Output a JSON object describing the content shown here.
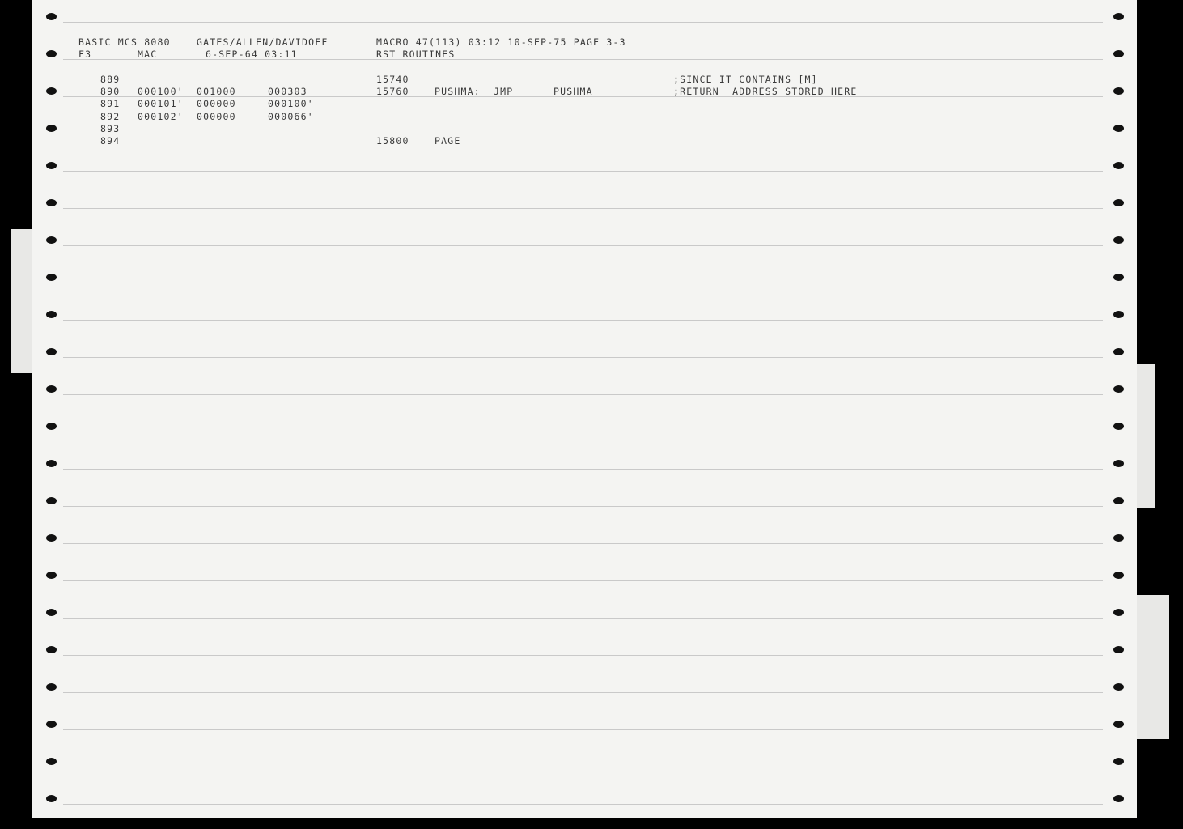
{
  "header": {
    "line1": {
      "program": "BASIC MCS 8080",
      "authors": "GATES/ALLEN/DAVIDOFF",
      "assembler": "MACRO 47(113) 03:12 10-SEP-75 PAGE 3-3"
    },
    "line2": {
      "file": "F3",
      "type": "MAC",
      "date": "6-SEP-64 03:11",
      "section": "RST ROUTINES"
    }
  },
  "listing": [
    {
      "line": "889",
      "loc": "",
      "word1": "",
      "word2": "",
      "seq": "15740",
      "label": "",
      "op": "",
      "arg": "",
      "comment": ";SINCE IT CONTAINS [M]"
    },
    {
      "line": "890",
      "loc": "000100'",
      "word1": "001000",
      "word2": "000303",
      "seq": "15760",
      "label": "PUSHMA:",
      "op": "JMP",
      "arg": "PUSHMA",
      "comment": ";RETURN  ADDRESS STORED HERE"
    },
    {
      "line": "891",
      "loc": "000101'",
      "word1": "000000",
      "word2": "000100'",
      "seq": "",
      "label": "",
      "op": "",
      "arg": "",
      "comment": ""
    },
    {
      "line": "892",
      "loc": "000102'",
      "word1": "000000",
      "word2": "000066'",
      "seq": "",
      "label": "",
      "op": "",
      "arg": "",
      "comment": ""
    },
    {
      "line": "893",
      "loc": "",
      "word1": "",
      "word2": "",
      "seq": "",
      "label": "",
      "op": "",
      "arg": "",
      "comment": ""
    },
    {
      "line": "894",
      "loc": "",
      "word1": "",
      "word2": "",
      "seq": "15800",
      "label": "PAGE",
      "op": "",
      "arg": "",
      "comment": ""
    }
  ]
}
